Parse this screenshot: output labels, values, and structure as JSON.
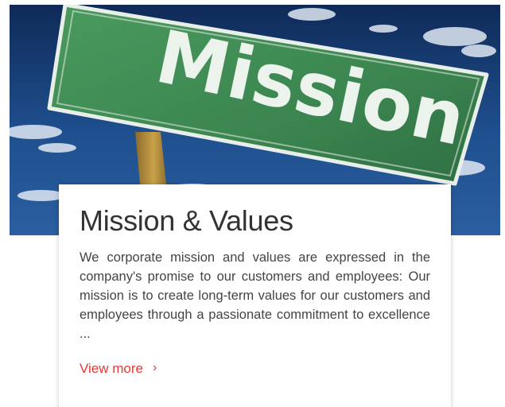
{
  "hero": {
    "sign_text": "Mission"
  },
  "card": {
    "title": "Mission & Values",
    "body": "We corporate mission and values are expressed in the company's promise to our customers and employees: Our mission is to create long-term values for our customers and employees through a passionate commitment to excellence ...",
    "link_label": "View more",
    "link_chevron": "›"
  },
  "colors": {
    "accent": "#e53935",
    "title": "#333333",
    "body_text": "#444444",
    "sign_green": "#3f8f55",
    "sky": "#1b3f7a"
  }
}
